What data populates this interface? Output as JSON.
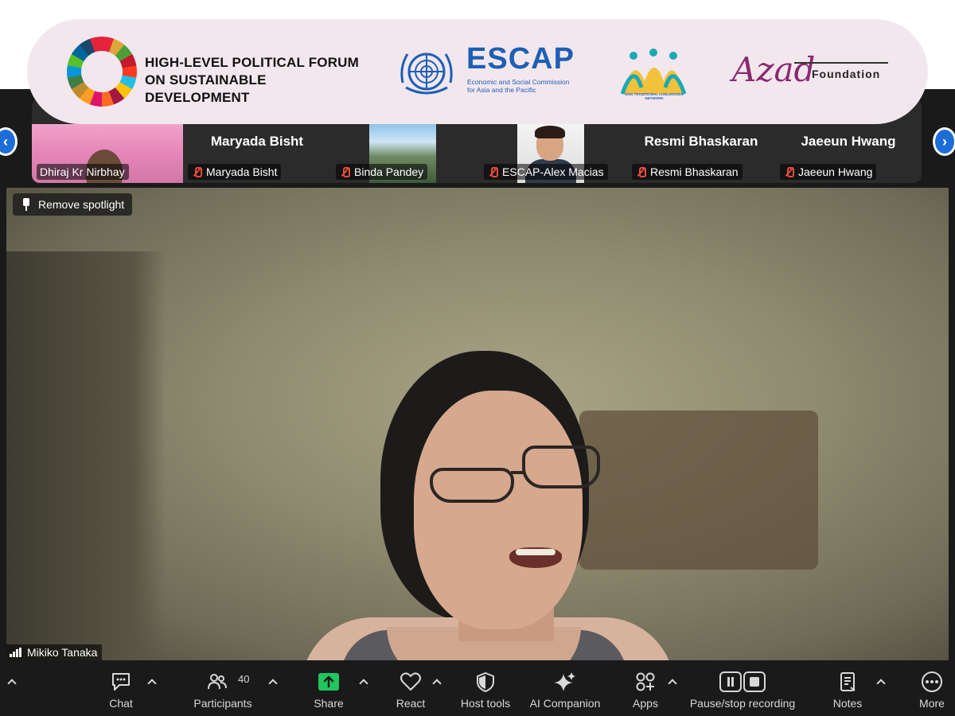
{
  "banner": {
    "hlpf_line1": "HIGH-LEVEL POLITICAL FORUM",
    "hlpf_line2": "ON SUSTAINABLE DEVELOPMENT",
    "escap_title": "ESCAP",
    "escap_sub_line1": "Economic and Social Commission",
    "escap_sub_line2": "for Asia and the Pacific",
    "ntln_text": "NON TRADITIONAL LIVELIHOODS NETWORK",
    "azad_word": "Azad",
    "azad_foundation": "Foundation"
  },
  "gallery": {
    "tiles": [
      {
        "label": "Dhiraj Kr Nirbhay",
        "muted": false
      },
      {
        "name": "Maryada Bisht",
        "label": "Maryada Bisht",
        "muted": true
      },
      {
        "label": "Binda Pandey",
        "muted": true
      },
      {
        "label": "ESCAP-Alex Macias",
        "muted": true
      },
      {
        "name": "Resmi Bhaskaran",
        "label": "Resmi Bhaskaran",
        "muted": true
      },
      {
        "name": "Jaeeun Hwang",
        "label": "Jaeeun Hwang",
        "muted": true
      }
    ],
    "prev_arrow": "‹",
    "next_arrow": "›"
  },
  "speaker": {
    "remove_spotlight": "Remove spotlight",
    "name": "Mikiko Tanaka"
  },
  "toolbar": {
    "chat": "Chat",
    "participants": "Participants",
    "participants_count": "40",
    "share": "Share",
    "react": "React",
    "host_tools": "Host tools",
    "ai_companion": "AI Companion",
    "apps": "Apps",
    "recording": "Pause/stop recording",
    "notes": "Notes",
    "more": "More"
  },
  "colors": {
    "share_green": "#22c55e",
    "nav_blue": "#1d6dd8",
    "muted_red": "#e74c3c",
    "escap_blue": "#1d5fb5",
    "azad_purple": "#8a2a6f"
  }
}
